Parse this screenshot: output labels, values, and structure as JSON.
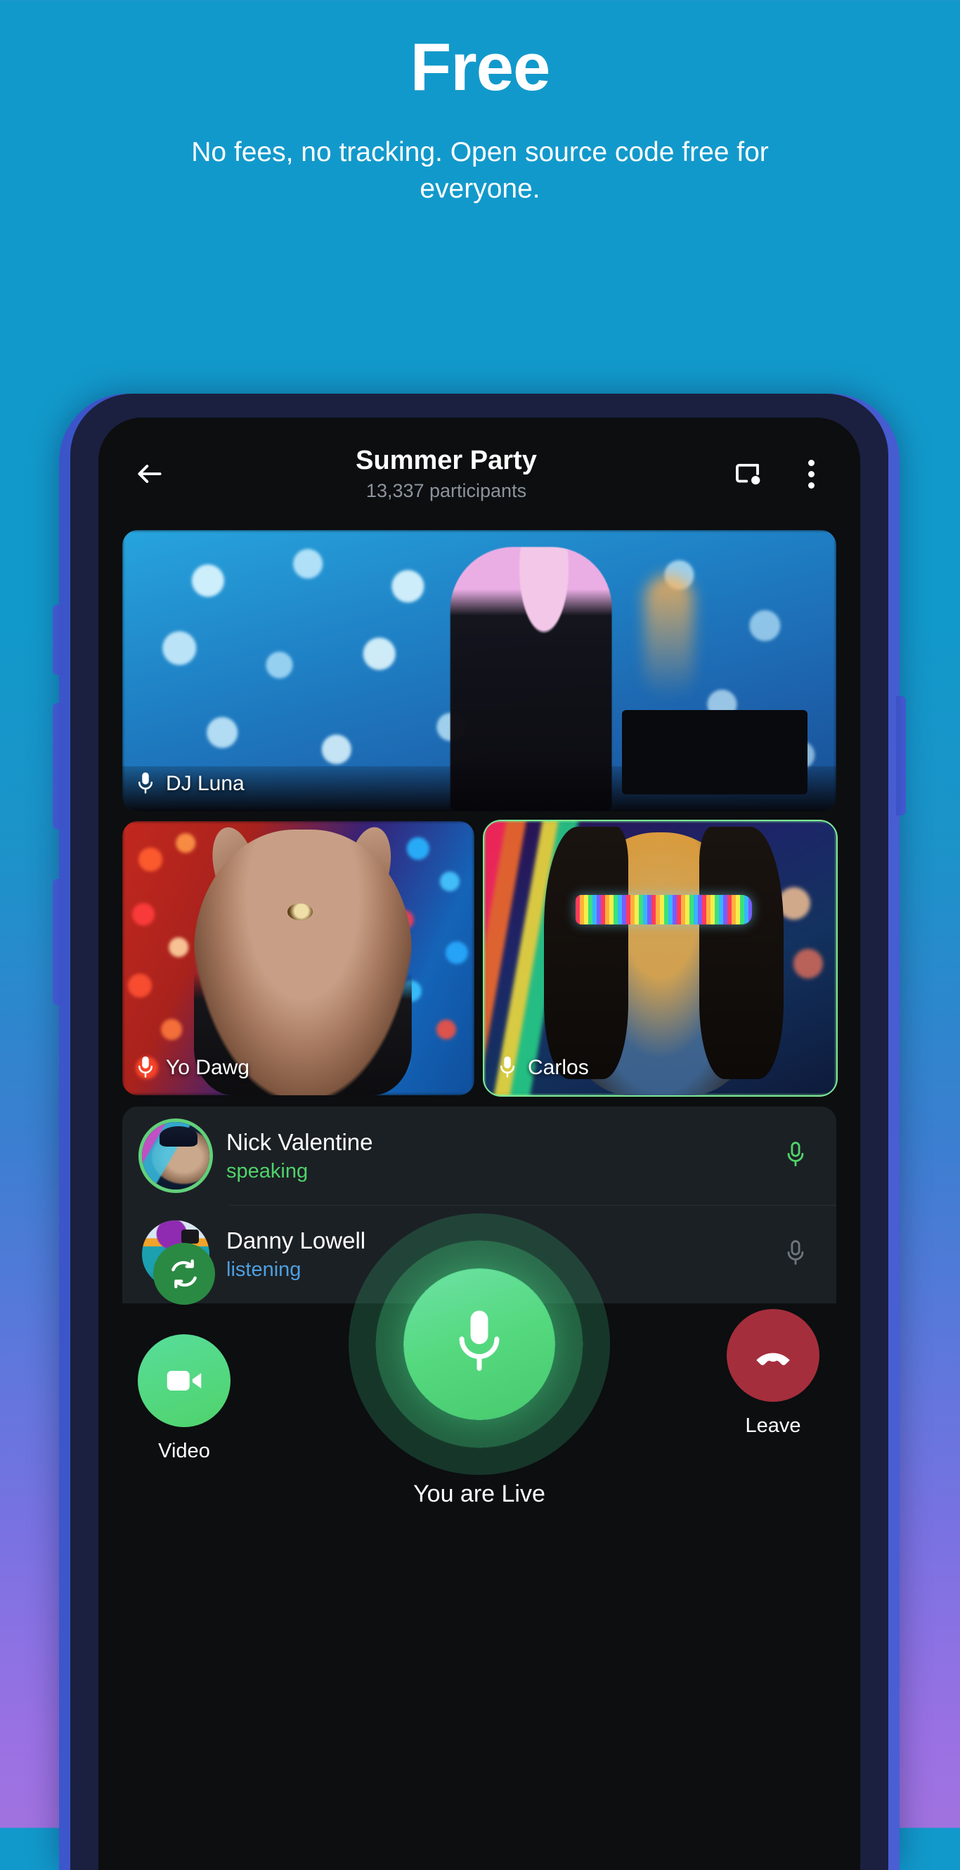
{
  "promo": {
    "title": "Free",
    "subtitle": "No fees, no tracking. Open source code free for everyone."
  },
  "colors": {
    "bg_top": "#1299cb",
    "bg_bottom": "#a072e0",
    "accent_green": "#4fd36b",
    "speaking_green": "#7ee895",
    "listening_blue": "#4f9fe0",
    "leave_red": "#a52e3c",
    "screen_black": "#0c0e10",
    "panel_gray": "#1b2024",
    "bezel_navy": "#1b2040",
    "phone_edge_blue": "#3b55c9"
  },
  "header": {
    "back_icon": "arrow-left-icon",
    "title": "Summer Party",
    "subtitle": "13,337 participants",
    "screen_share_icon": "screen-share-icon",
    "more_icon": "more-vertical-icon"
  },
  "video_tiles": [
    {
      "name": "DJ Luna",
      "mic_icon": "microphone-icon",
      "active_speaker": false,
      "layout": "full"
    },
    {
      "name": "Yo Dawg",
      "mic_icon": "microphone-icon",
      "active_speaker": false,
      "layout": "half"
    },
    {
      "name": "Carlos",
      "mic_icon": "microphone-icon",
      "active_speaker": true,
      "layout": "half"
    }
  ],
  "participants": [
    {
      "name": "Nick Valentine",
      "status": "speaking",
      "mic_icon": "microphone-icon",
      "mic_active": true
    },
    {
      "name": "Danny Lowell",
      "status": "listening",
      "mic_icon": "microphone-icon",
      "mic_active": false
    }
  ],
  "controls": {
    "flip_camera_icon": "flip-camera-icon",
    "video_icon": "video-camera-icon",
    "video_label": "Video",
    "mic_icon": "microphone-icon",
    "live_label": "You are Live",
    "leave_icon": "phone-hangup-icon",
    "leave_label": "Leave"
  }
}
